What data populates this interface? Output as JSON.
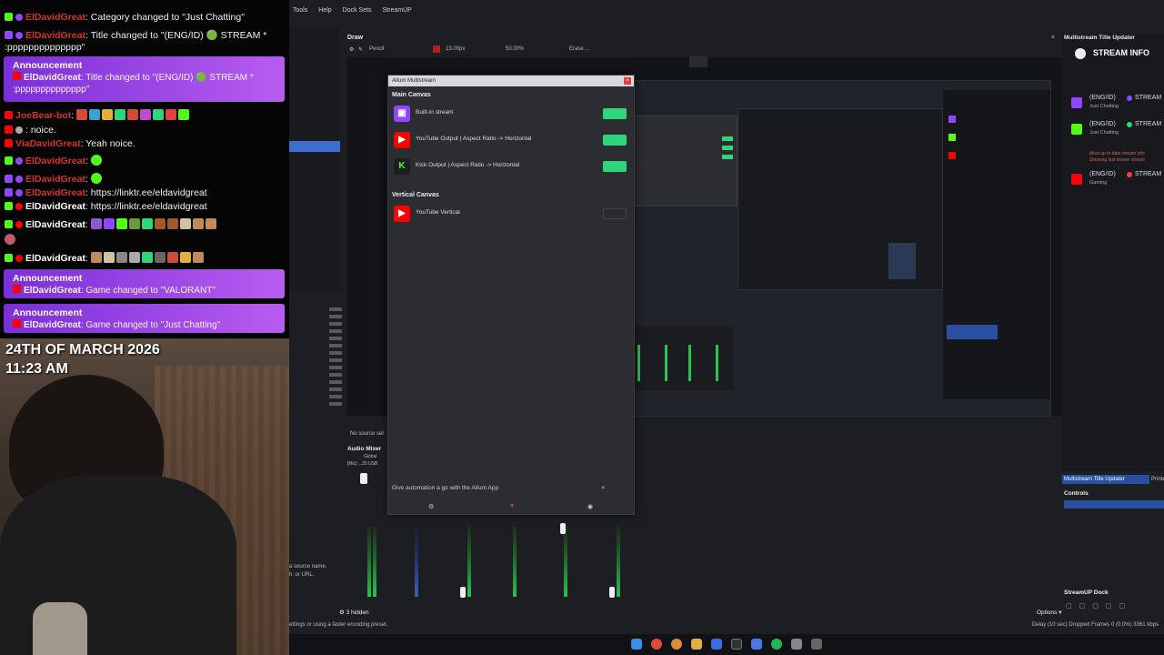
{
  "chat": {
    "messages": [
      {
        "platform": "kick",
        "user": "ElDavidGreat",
        "text": ": Category changed to \"Just Chatting\""
      },
      {
        "platform": "twitch",
        "user": "ElDavidGreat",
        "text": ": Title changed to \"(ENG/ID) 🟢 STREAM *"
      },
      {
        "platform": "",
        "user": "",
        "text": ":pppppppppppppp\""
      },
      {
        "platform": "yt",
        "user": "JoeBear-bot",
        "text": ":"
      },
      {
        "platform": "yt",
        "user": "",
        "text": ": noice."
      },
      {
        "platform": "yt",
        "user": "ViaDavidGreat",
        "text": ": Yeah noice."
      },
      {
        "platform": "kick",
        "user": "ElDavidGreat",
        "text": ":"
      },
      {
        "platform": "twitch",
        "user": "ElDavidGreat",
        "text": ":"
      },
      {
        "platform": "twitch",
        "user": "ElDavidGreat",
        "text": ": https://linktr.ee/eldavidgreat"
      },
      {
        "platform": "kick",
        "user": "ElDavidGreat",
        "text": ": https://linktr.ee/eldavidgreat"
      },
      {
        "platform": "kick",
        "user": "ElDavidGreat",
        "text": ":"
      },
      {
        "platform": "kick",
        "user": "ElDavidGreat",
        "text": ":"
      }
    ],
    "announcements": [
      {
        "title": "Announcement",
        "user": "ElDavidGreat",
        "text": ": Title changed to \"(ENG/ID) 🟢 STREAM *",
        "text2": ":pppppppppppppp\""
      },
      {
        "title": "Announcement",
        "user": "ElDavidGreat",
        "text": ": Game changed to \"VALORANT\""
      },
      {
        "title": "Announcement",
        "user": "ElDavidGreat",
        "text": ": Game changed to \"Just Chatting\""
      }
    ]
  },
  "webcam": {
    "date": "24TH OF MARCH 2026",
    "time": "11:23 AM"
  },
  "obs": {
    "menu": [
      "Tools",
      "Help",
      "Dock Sets",
      "StreamUP"
    ],
    "draw": {
      "title": "Draw",
      "tool": "Pencil",
      "size": "13.00px",
      "opacity": "50.00%",
      "erase": "Erase ..."
    },
    "multistream": {
      "title": "Aitum Multistream",
      "main_canvas": "Main Canvas",
      "vertical_canvas": "Vertical Canvas",
      "outputs": [
        {
          "label": "Built-in stream",
          "icon": "twitch-icon",
          "color": "#9146ff",
          "on": true
        },
        {
          "label": "YouTube Output | Aspect Ratio -> Horizontal",
          "icon": "youtube-icon",
          "color": "#ff0000",
          "on": true
        },
        {
          "label": "Kick Output | Aspect Ratio -> Horizontal",
          "icon": "kick-icon",
          "color": "#53fc18",
          "on": true
        }
      ],
      "vertical_outputs": [
        {
          "label": "YouTube Vertical",
          "icon": "youtube-icon",
          "color": "#ff0000",
          "on": false
        }
      ],
      "automation": "Give automation a go with the Aitum App"
    },
    "title_updater": {
      "header": "Multistream Title Updater",
      "stream_info": "STREAM INFO",
      "rows": [
        {
          "platform": "twitch",
          "lang": "(ENG/ID)",
          "title": "STREAM",
          "sub": "Just Chatting",
          "color": "#9146ff",
          "dot": "#9146ff"
        },
        {
          "platform": "kick",
          "lang": "(ENG/ID)",
          "title": "STREAM",
          "sub": "Just Chatting",
          "color": "#53fc18",
          "dot": "#2dd67a"
        },
        {
          "platform": "yt",
          "lang": "(ENG/ID)",
          "title": "STREAM",
          "sub": "Gaming",
          "color": "#ff0000",
          "dot": "#ff3b3b"
        }
      ],
      "note1": "Most up to date stream info",
      "note2": "Showing last known stream"
    },
    "audio": {
      "title": "Audio Mixer",
      "global": "Global",
      "mic": "[Mic] ...20 USB"
    },
    "docks": {
      "tab1": "Multistream Title Updater",
      "tab2": "Printer",
      "controls": "Controls",
      "streamup": "StreamUP Dock"
    },
    "hidden": "3 hidden",
    "options": "Options",
    "no_source": "No source sel",
    "source_hint1": "a source name,",
    "source_hint2": "h, or URL.",
    "status_left": "ettings or using a faster encoding preset.",
    "status_right": "Delay (10 sec) Dropped Frames 0 (0.0%) 3361 kbps"
  }
}
